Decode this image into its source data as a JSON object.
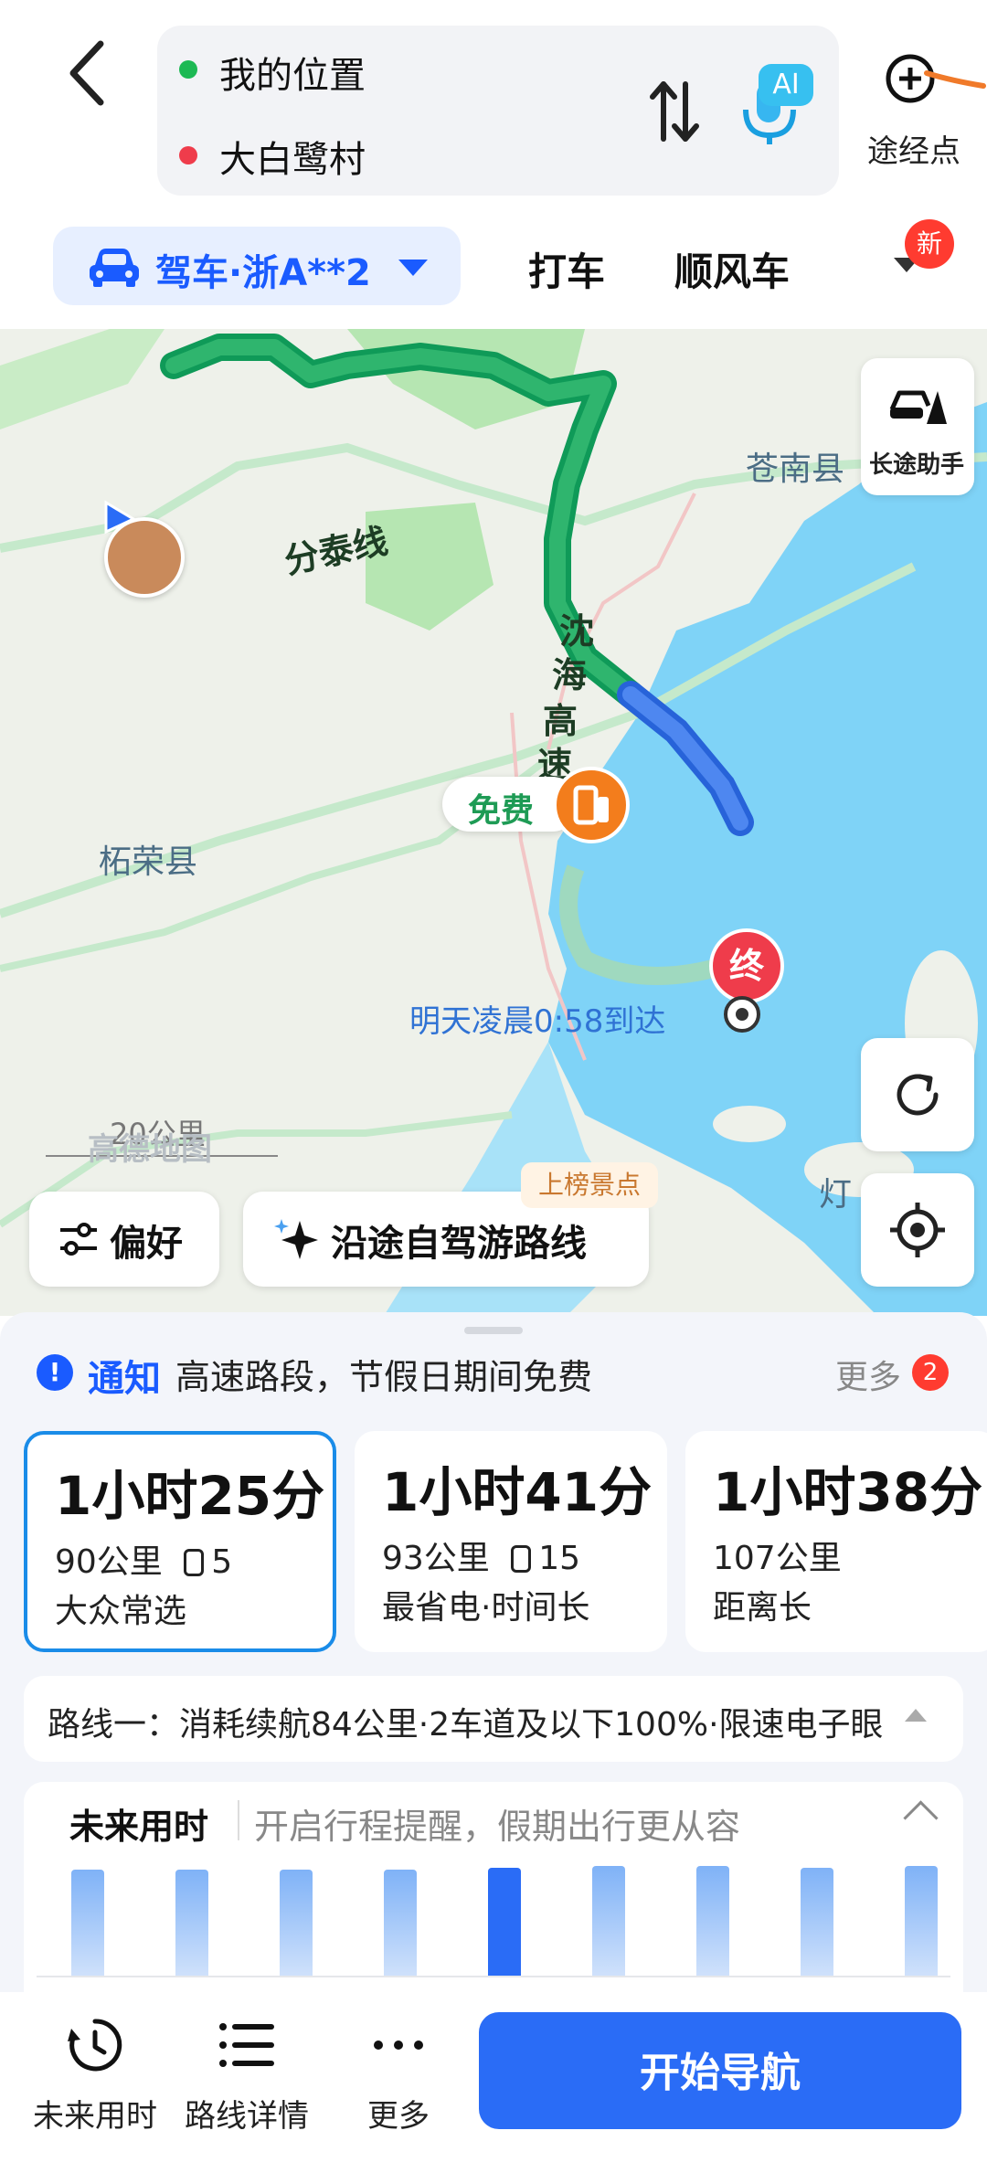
{
  "header": {
    "origin": "我的位置",
    "destination": "大白鹭村",
    "ai_badge": "AI",
    "waypoint_label": "途经点",
    "origin_color": "#1db954",
    "destination_color": "#ef3c4b"
  },
  "mode_tabs": {
    "driving_label": "驾车·浙A**2",
    "taxi_label": "打车",
    "carpool_label": "顺风车",
    "new_badge": "新"
  },
  "map": {
    "labels": {
      "cangnan": "苍南县",
      "zherong": "柘荣县",
      "lighthouse": "灯",
      "road1": "分泰线",
      "road2_chars": [
        "沈",
        "海",
        "高",
        "速"
      ]
    },
    "long_trip_assistant": "长途助手",
    "free_tag": "免费",
    "arrival": "明天凌晨0:58到达",
    "end_marker": "终",
    "scale": "20公里",
    "watermark": "高德地图",
    "preference_chip": "偏好",
    "selfdrive_chip": "沿途自驾游路线",
    "rank_badge": "上榜景点"
  },
  "sheet": {
    "notice_icon": "!",
    "notice_title": "通知",
    "notice_text": "高速路段，节假日期间免费",
    "more_label": "更多",
    "more_count": "2",
    "routes": [
      {
        "time": "1小时25分",
        "distance": "90公里",
        "lights": "5",
        "tag": "大众常选",
        "selected": true
      },
      {
        "time": "1小时41分",
        "distance": "93公里",
        "lights": "15",
        "tag": "最省电·时间长",
        "selected": false
      },
      {
        "time": "1小时38分",
        "distance": "107公里",
        "lights": "",
        "tag": "距离长",
        "selected": false
      }
    ],
    "route_summary": "路线一：消耗续航84公里·2车道及以下100%·限速电子眼",
    "future_title": "未来用时",
    "future_text": "开启行程提醒，假期出行更从容",
    "future_bars": [
      0.55,
      0.55,
      0.55,
      0.55,
      0.56,
      0.57,
      0.57,
      0.56,
      0.57
    ],
    "future_current_index": 4
  },
  "bottom_nav": {
    "future_time": "未来用时",
    "route_details": "路线详情",
    "more": "更多",
    "start_navigation": "开始导航",
    "primary_color": "#2a6cf6"
  }
}
